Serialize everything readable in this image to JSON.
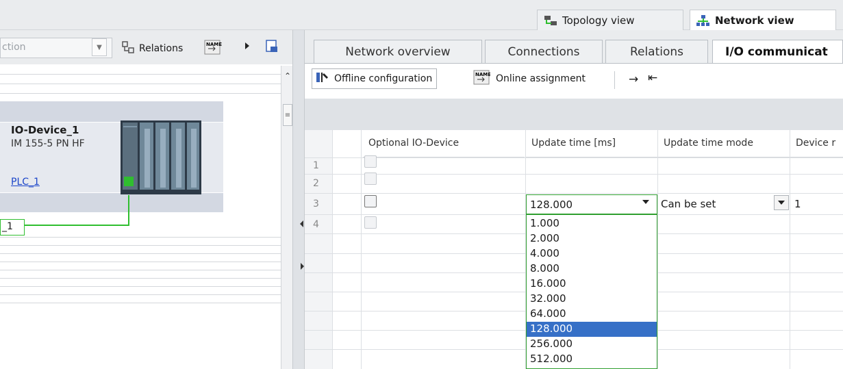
{
  "view_tabs": {
    "topology": "Topology view",
    "network": "Network view"
  },
  "left_toolbar": {
    "combo_value": "ction",
    "relations": "Relations"
  },
  "device": {
    "name": "IO-Device_1",
    "type": "IM 155-5 PN HF",
    "link": "PLC_1",
    "port_label": "_1"
  },
  "colors": {
    "accent_green": "#2fbe2f",
    "selection_blue": "#3670c7",
    "link_blue": "#1a44c9"
  },
  "right_tabs": [
    "Network overview",
    "Connections",
    "Relations",
    "I/O communicat"
  ],
  "right_toolbar": {
    "offline": "Offline configuration",
    "online": "Online assignment"
  },
  "table": {
    "headers": [
      "Optional IO-Device",
      "Update time [ms]",
      "Update time mode",
      "Device r"
    ],
    "rows": [
      {
        "num": "1"
      },
      {
        "num": "2"
      },
      {
        "num": "3",
        "update_time": "128.000",
        "mode": "Can be set",
        "device": "1"
      },
      {
        "num": "4"
      }
    ]
  },
  "dropdown_options": [
    "1.000",
    "2.000",
    "4.000",
    "8.000",
    "16.000",
    "32.000",
    "64.000",
    "128.000",
    "256.000",
    "512.000"
  ],
  "selected_option": "128.000"
}
